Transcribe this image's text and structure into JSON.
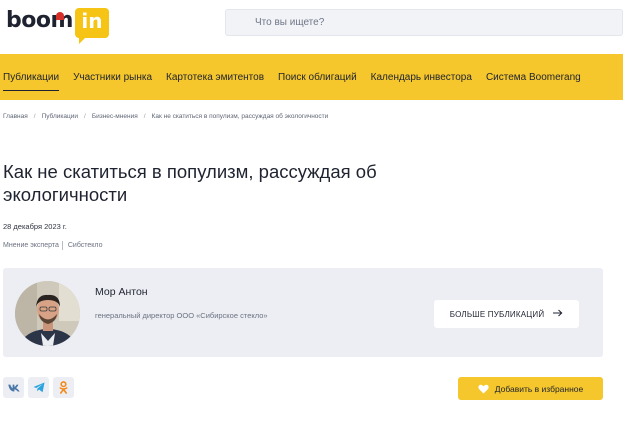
{
  "header": {
    "logo_text": "boom",
    "logo_badge": "in",
    "search_placeholder": "Что вы ищете?"
  },
  "nav": {
    "items": [
      {
        "label": "Публикации",
        "active": true
      },
      {
        "label": "Участники рынка",
        "active": false
      },
      {
        "label": "Картотека эмитентов",
        "active": false
      },
      {
        "label": "Поиск облигаций",
        "active": false
      },
      {
        "label": "Календарь инвестора",
        "active": false
      },
      {
        "label": "Система Boomerang",
        "active": false
      }
    ]
  },
  "breadcrumb": {
    "items": [
      "Главная",
      "Публикации",
      "Бизнес-мнения",
      "Как не скатиться в популизм, рассуждая об экологичности"
    ],
    "separator": "/"
  },
  "article": {
    "title": "Как не скатиться в популизм, рассуждая об экологичности",
    "date": "28 декабря 2023 г.",
    "tags": [
      "Мнение эксперта",
      "Сибстекло"
    ]
  },
  "author": {
    "name": "Мор Антон",
    "role": "генеральный директор ООО «Сибирское стекло»",
    "more_label": "БОЛЬШЕ ПУБЛИКАЦИЙ",
    "more_icon": "arrow-right-icon"
  },
  "share": {
    "icons": [
      "vk-icon",
      "telegram-icon",
      "odnoklassniki-icon"
    ]
  },
  "favorite": {
    "label": "Добавить в избранное",
    "icon": "heart-icon"
  },
  "colors": {
    "accent": "#f5c72c",
    "card_bg": "#eceef3",
    "text": "#1f2330",
    "logo_red": "#d6302b"
  }
}
